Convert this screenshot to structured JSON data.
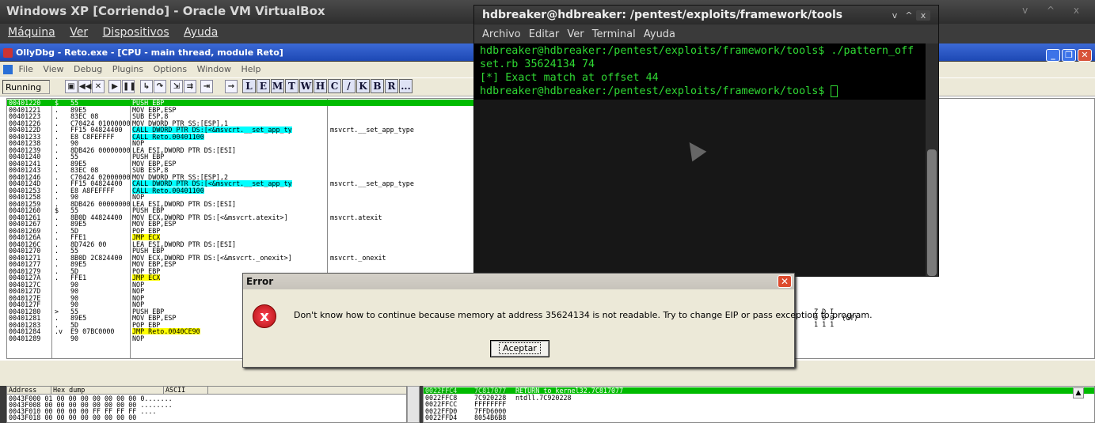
{
  "vbox": {
    "title": "Windows XP [Corriendo] - Oracle VM VirtualBox",
    "controls": "v ^ x",
    "menu": [
      "Máquina",
      "Ver",
      "Dispositivos",
      "Ayuda"
    ]
  },
  "olly": {
    "title": "OllyDbg - Reto.exe - [CPU - main thread, module Reto]",
    "menu": [
      "File",
      "View",
      "Debug",
      "Plugins",
      "Options",
      "Window",
      "Help"
    ],
    "status": "Running",
    "letter_buttons": [
      "L",
      "E",
      "M",
      "T",
      "W",
      "H",
      "C",
      "/",
      "K",
      "B",
      "R",
      "..."
    ],
    "disasm": [
      {
        "addr": "00401220",
        "mk": "$",
        "hex": "55",
        "ins": "PUSH EBP",
        "cmt": "",
        "sel": true
      },
      {
        "addr": "00401221",
        "mk": ".",
        "hex": "89E5",
        "ins": "MOV EBP,ESP",
        "cmt": ""
      },
      {
        "addr": "00401223",
        "mk": ".",
        "hex": "83EC 08",
        "ins": "SUB ESP,8",
        "cmt": ""
      },
      {
        "addr": "00401226",
        "mk": ".",
        "hex": "C70424 01000000",
        "ins": "MOV DWORD PTR SS:[ESP],1",
        "cmt": ""
      },
      {
        "addr": "0040122D",
        "mk": ".",
        "hex": "FF15 04824400",
        "ins": "CALL DWORD PTR DS:[<&msvcrt.__set_app_ty",
        "cmt": "msvcrt.__set_app_type",
        "hl": "cy"
      },
      {
        "addr": "00401233",
        "mk": ".",
        "hex": "E8 C8FEFFFF",
        "ins": "CALL Reto.00401100",
        "cmt": "",
        "hl": "cy"
      },
      {
        "addr": "00401238",
        "mk": ".",
        "hex": "90",
        "ins": "NOP",
        "cmt": ""
      },
      {
        "addr": "00401239",
        "mk": ".",
        "hex": "8DB426 00000000",
        "ins": "LEA ESI,DWORD PTR DS:[ESI]",
        "cmt": ""
      },
      {
        "addr": "00401240",
        "mk": ".",
        "hex": "55",
        "ins": "PUSH EBP",
        "cmt": ""
      },
      {
        "addr": "00401241",
        "mk": ".",
        "hex": "89E5",
        "ins": "MOV EBP,ESP",
        "cmt": ""
      },
      {
        "addr": "00401243",
        "mk": ".",
        "hex": "83EC 08",
        "ins": "SUB ESP,8",
        "cmt": ""
      },
      {
        "addr": "00401246",
        "mk": ".",
        "hex": "C70424 02000000",
        "ins": "MOV DWORD PTR SS:[ESP],2",
        "cmt": ""
      },
      {
        "addr": "0040124D",
        "mk": ".",
        "hex": "FF15 04824400",
        "ins": "CALL DWORD PTR DS:[<&msvcrt.__set_app_ty",
        "cmt": "msvcrt.__set_app_type",
        "hl": "cy"
      },
      {
        "addr": "00401253",
        "mk": ".",
        "hex": "E8 A8FEFFFF",
        "ins": "CALL Reto.00401100",
        "cmt": "",
        "hl": "cy"
      },
      {
        "addr": "00401258",
        "mk": ".",
        "hex": "90",
        "ins": "NOP",
        "cmt": ""
      },
      {
        "addr": "00401259",
        "mk": ".",
        "hex": "8DB426 00000000",
        "ins": "LEA ESI,DWORD PTR DS:[ESI]",
        "cmt": ""
      },
      {
        "addr": "00401260",
        "mk": "$",
        "hex": "55",
        "ins": "PUSH EBP",
        "cmt": ""
      },
      {
        "addr": "00401261",
        "mk": ".",
        "hex": "8B0D 44824400",
        "ins": "MOV ECX,DWORD PTR DS:[<&msvcrt.atexit>]",
        "cmt": "msvcrt.atexit"
      },
      {
        "addr": "00401267",
        "mk": ".",
        "hex": "89E5",
        "ins": "MOV EBP,ESP",
        "cmt": ""
      },
      {
        "addr": "00401269",
        "mk": ".",
        "hex": "5D",
        "ins": "POP EBP",
        "cmt": ""
      },
      {
        "addr": "0040126A",
        "mk": ".",
        "hex": "FFE1",
        "ins": "JMP ECX",
        "cmt": "",
        "hl": "ye"
      },
      {
        "addr": "0040126C",
        "mk": ".",
        "hex": "8D7426 00",
        "ins": "LEA ESI,DWORD PTR DS:[ESI]",
        "cmt": ""
      },
      {
        "addr": "00401270",
        "mk": ".",
        "hex": "55",
        "ins": "PUSH EBP",
        "cmt": ""
      },
      {
        "addr": "00401271",
        "mk": ".",
        "hex": "8B0D 2C824400",
        "ins": "MOV ECX,DWORD PTR DS:[<&msvcrt._onexit>]",
        "cmt": "msvcrt._onexit"
      },
      {
        "addr": "00401277",
        "mk": ".",
        "hex": "89E5",
        "ins": "MOV EBP,ESP",
        "cmt": ""
      },
      {
        "addr": "00401279",
        "mk": ".",
        "hex": "5D",
        "ins": "POP EBP",
        "cmt": ""
      },
      {
        "addr": "0040127A",
        "mk": ".",
        "hex": "FFE1",
        "ins": "JMP ECX",
        "cmt": "",
        "hl": "ye"
      },
      {
        "addr": "0040127C",
        "mk": "",
        "hex": "90",
        "ins": "NOP",
        "cmt": ""
      },
      {
        "addr": "0040127D",
        "mk": "",
        "hex": "90",
        "ins": "NOP",
        "cmt": ""
      },
      {
        "addr": "0040127E",
        "mk": "",
        "hex": "90",
        "ins": "NOP",
        "cmt": ""
      },
      {
        "addr": "0040127F",
        "mk": "",
        "hex": "90",
        "ins": "NOP",
        "cmt": ""
      },
      {
        "addr": "00401280",
        "mk": ">",
        "hex": "55",
        "ins": "PUSH EBP",
        "cmt": ""
      },
      {
        "addr": "00401281",
        "mk": ".",
        "hex": "89E5",
        "ins": "MOV EBP,ESP",
        "cmt": ""
      },
      {
        "addr": "00401283",
        "mk": ".",
        "hex": "5D",
        "ins": "POP EBP",
        "cmt": ""
      },
      {
        "addr": "00401284",
        "mk": ".v",
        "hex": "E9 07BC0000",
        "ins": "JMP Reto.0040CE90",
        "cmt": "",
        "hl": "ye"
      },
      {
        "addr": "00401289",
        "mk": "",
        "hex": "90",
        "ins": "NOP",
        "cmt": ""
      }
    ],
    "regs_flags": "Z D I\n0 0 0  (GT)\n1 1 1",
    "dump_headers": [
      "Address",
      "Hex dump",
      "ASCII"
    ],
    "dump_rows": [
      "0043F000 01 00 00 00 00 00 00 00 0.......",
      "0043F008 00 00 00 00 00 00 00 00 ........",
      "0043F010 00 00 00 00 FF FF FF FF ....",
      "0043F018 00 00 00 00 00 00 00 00"
    ],
    "stack": [
      {
        "a": "0022FFC4",
        "v": "7C817077",
        "c": "RETURN to kernel32.7C817077",
        "sel": true
      },
      {
        "a": "0022FFC8",
        "v": "7C920228",
        "c": "ntdll.7C920228"
      },
      {
        "a": "0022FFCC",
        "v": "FFFFFFFF",
        "c": ""
      },
      {
        "a": "0022FFD0",
        "v": "7FFD6000",
        "c": ""
      },
      {
        "a": "0022FFD4",
        "v": "8054B6B8",
        "c": ""
      }
    ]
  },
  "terminal": {
    "title": "hdbreaker@hdbreaker: /pentest/exploits/framework/tools",
    "controls": [
      "v",
      "^",
      "x"
    ],
    "menu": [
      "Archivo",
      "Editar",
      "Ver",
      "Terminal",
      "Ayuda"
    ],
    "line1": "hdbreaker@hdbreaker:/pentest/exploits/framework/tools$ ./pattern_offset.rb 35624134 74",
    "line2": "[*] Exact match at offset 44",
    "line3": "hdbreaker@hdbreaker:/pentest/exploits/framework/tools$ "
  },
  "error": {
    "title": "Error",
    "icon": "x",
    "message": "Don't know how to continue because memory at address 35624134 is not readable. Try to change EIP or pass exception to program.",
    "button": "Aceptar"
  },
  "colors": {
    "terminal_green": "#2fd833",
    "olly_selection": "#00bb00",
    "olly_call": "#00ffff",
    "olly_jump": "#ffff00"
  }
}
